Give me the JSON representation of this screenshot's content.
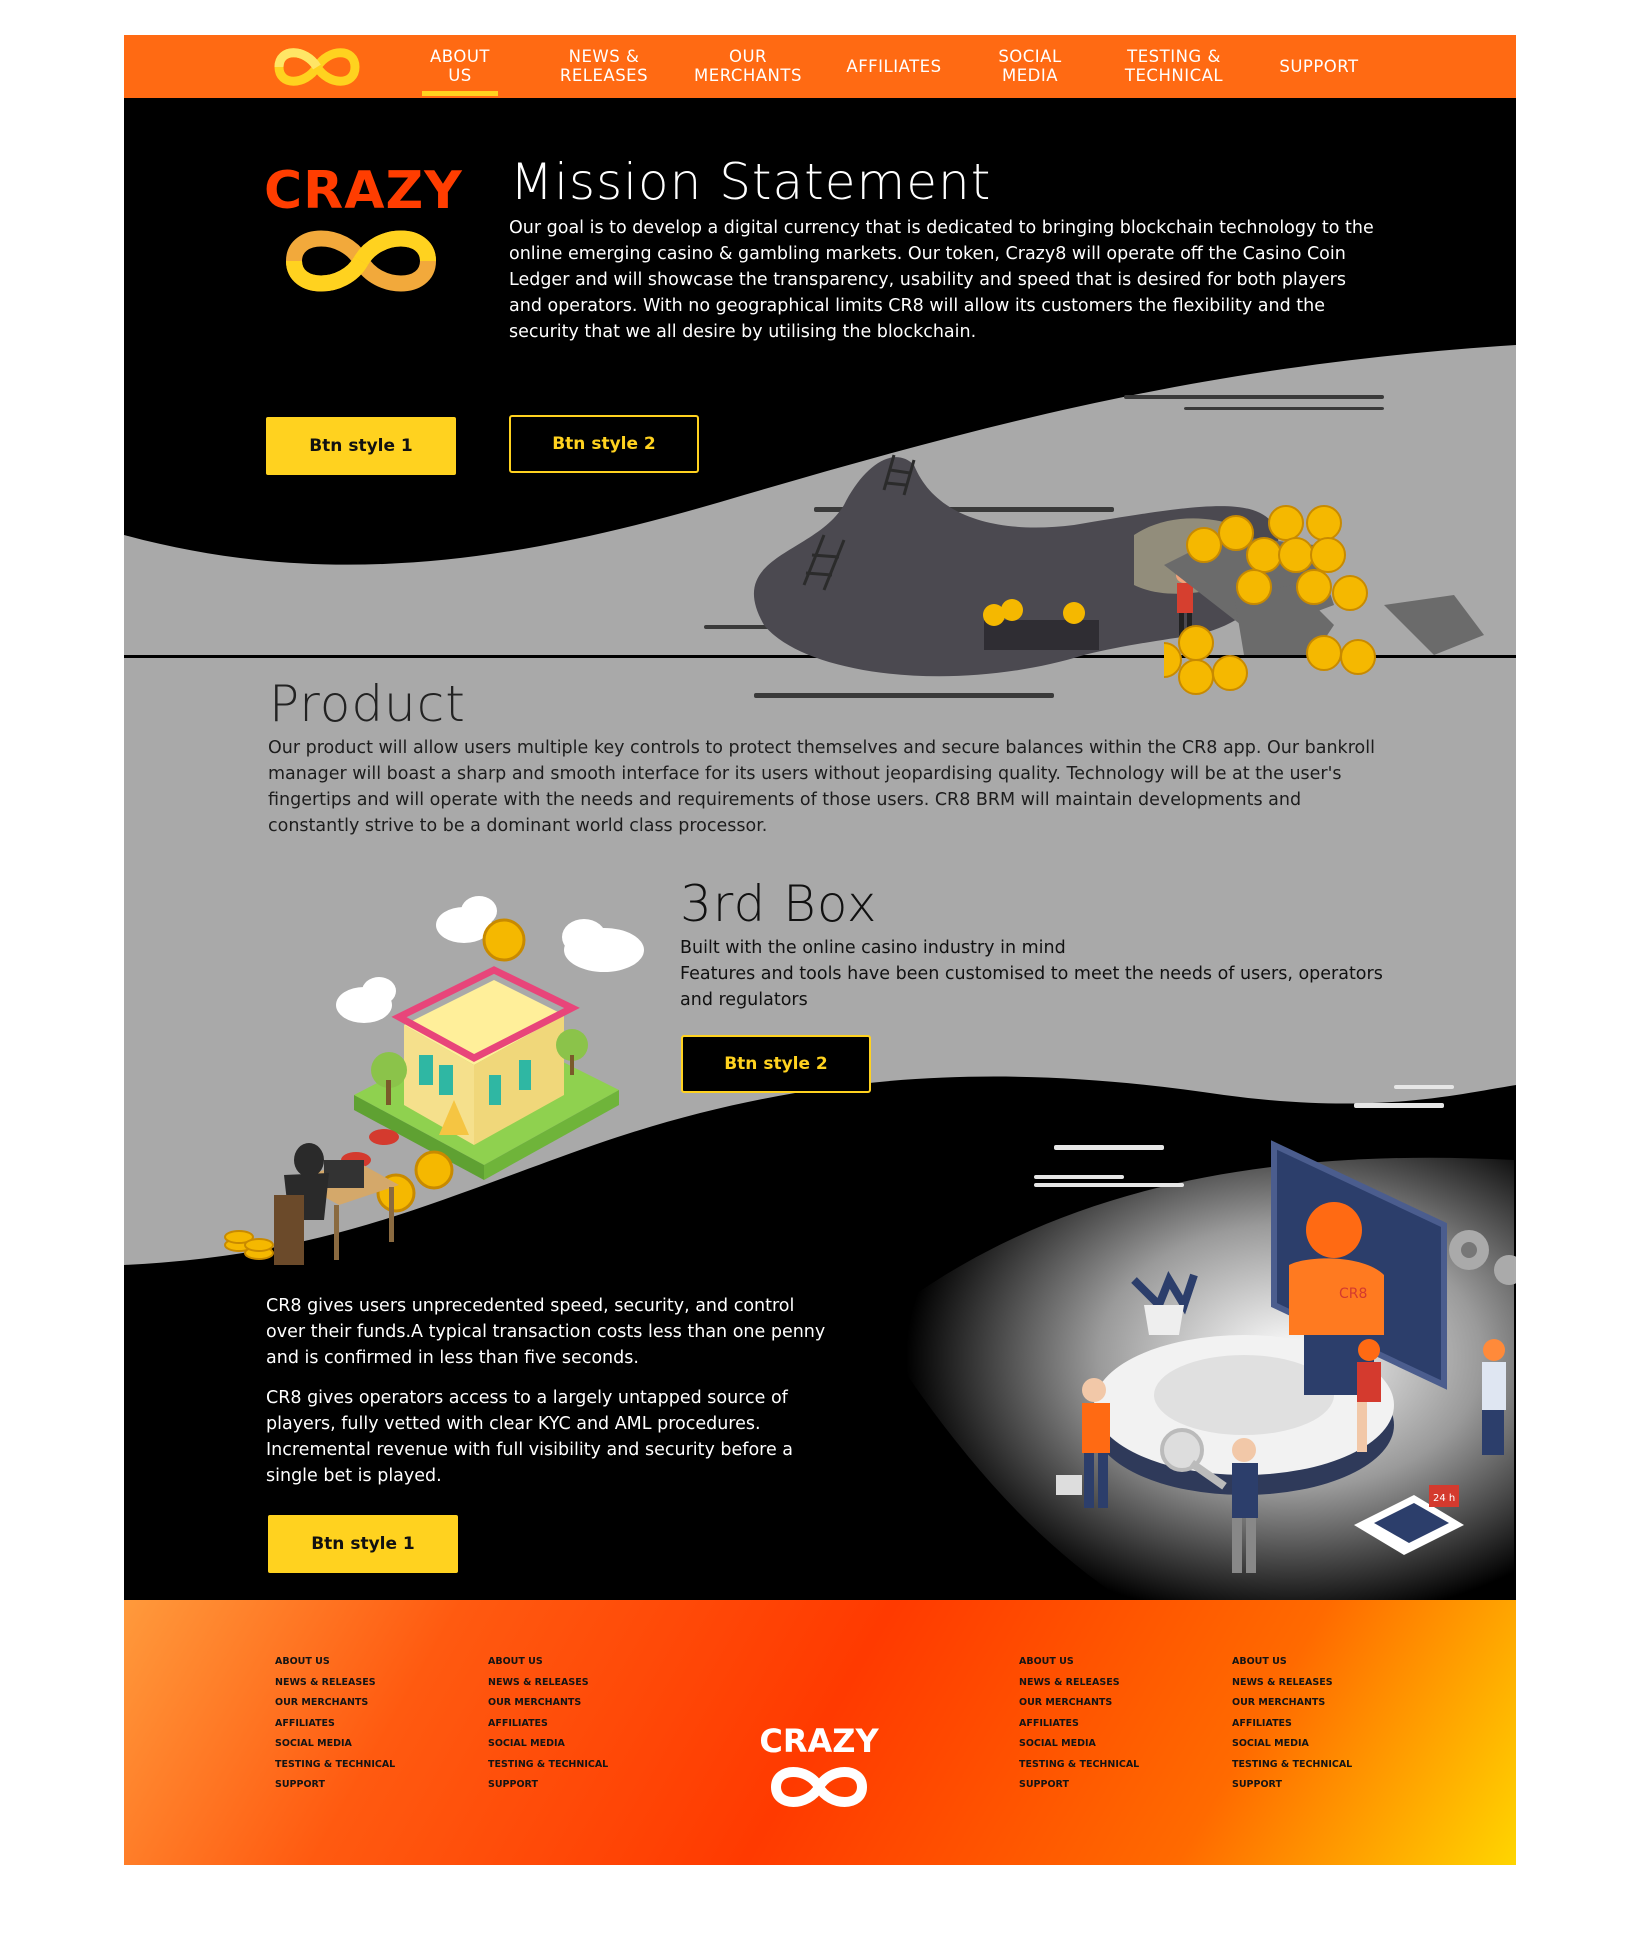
{
  "nav": {
    "items": [
      "ABOUT US",
      "NEWS & RELEASES",
      "OUR MERCHANTS",
      "AFFILIATES",
      "SOCIAL MEDIA",
      "TESTING & TECHNICAL",
      "SUPPORT"
    ],
    "lines": [
      [
        "ABOUT",
        "US"
      ],
      [
        "NEWS &",
        "RELEASES"
      ],
      [
        "OUR",
        "MERCHANTS"
      ],
      [
        "AFFILIATES"
      ],
      [
        "SOCIAL",
        "MEDIA"
      ],
      [
        "TESTING &",
        "TECHNICAL"
      ],
      [
        "SUPPORT"
      ]
    ],
    "active": "ABOUT US"
  },
  "brand": {
    "name": "CRAZY"
  },
  "mission": {
    "title": "Mission Statement",
    "body": "Our goal is to develop a digital currency that is dedicated to bringing blockchain technology to the online emerging casino & gambling markets. Our token, Crazy8 will operate off the Casino Coin Ledger and will showcase the transparency, usability and speed that is desired for both players and operators. With no geographical limits CR8 will allow its customers the flexibility and the security that we all desire by utilising the blockchain.",
    "btn1": "Btn style 1",
    "btn2": "Btn style 2"
  },
  "product": {
    "title": "Product",
    "body": "Our product will allow users multiple key controls to protect themselves and secure balances within the CR8 app. Our bankroll manager will boast a sharp and smooth interface for its users without jeopardising quality. Technology will be at the user's fingertips and will operate with the needs and requirements of those users. CR8 BRM will maintain developments and constantly strive to be a dominant world class processor."
  },
  "third": {
    "title": "3rd Box",
    "line1": "Built with the online casino industry in mind",
    "line2": "Features and tools have been customised to meet the needs of users, operators and regulators",
    "btn": "Btn style 2"
  },
  "cr8": {
    "para1": "CR8 gives users unprecedented speed, security, and control over their funds.A typical transaction costs less than one penny and is confirmed in less than five seconds.",
    "para2": "CR8 gives operators access to a largely untapped source of players, fully vetted with clear KYC and AML procedures. Incremental revenue with full visibility and security before a single bet is played.",
    "btn": "Btn style 1",
    "screen_label": "CR8",
    "badge_label": "24 h"
  },
  "footer": {
    "columns": [
      [
        "ABOUT US",
        "NEWS & RELEASES",
        "OUR MERCHANTS",
        "AFFILIATES",
        "SOCIAL MEDIA",
        "TESTING & TECHNICAL",
        "SUPPORT"
      ],
      [
        "ABOUT US",
        "NEWS & RELEASES",
        "OUR MERCHANTS",
        "AFFILIATES",
        "SOCIAL MEDIA",
        "TESTING & TECHNICAL",
        "SUPPORT"
      ],
      [
        "ABOUT US",
        "NEWS & RELEASES",
        "OUR MERCHANTS",
        "AFFILIATES",
        "SOCIAL MEDIA",
        "TESTING & TECHNICAL",
        "SUPPORT"
      ],
      [
        "ABOUT US",
        "NEWS & RELEASES",
        "OUR MERCHANTS",
        "AFFILIATES",
        "SOCIAL MEDIA",
        "TESTING & TECHNICAL",
        "SUPPORT"
      ]
    ]
  },
  "colors": {
    "nav_orange": "#ff6a13",
    "button_yellow": "#ffd21f",
    "logo_red": "#ff3d00",
    "background_gray": "#a9a9a9",
    "coin_gold": "#f5b800"
  },
  "icons": [
    "infinity-logo-icon",
    "crazy-logo",
    "coin-icon",
    "gear-icon",
    "cloud-icon"
  ]
}
